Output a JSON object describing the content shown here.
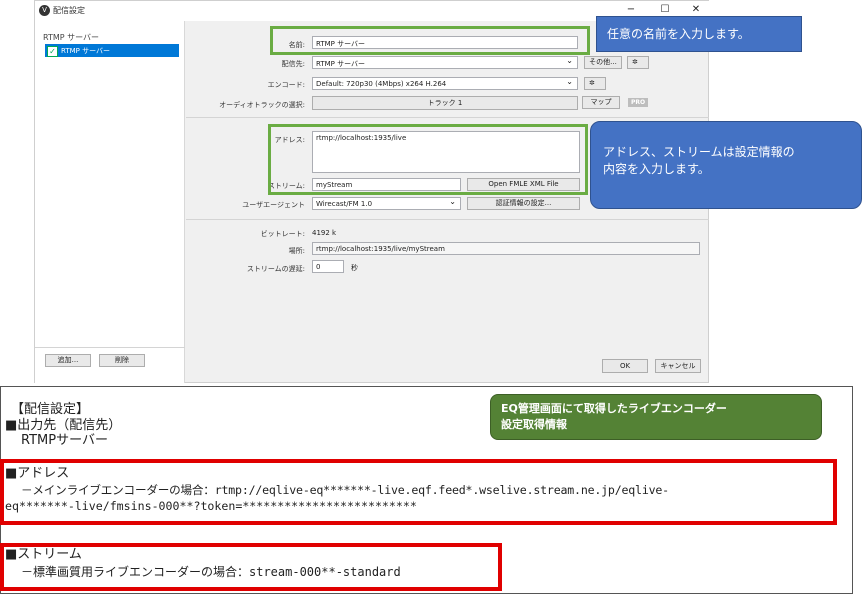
{
  "window": {
    "title": "配信設定",
    "app_icon": "V",
    "controls": [
      "−",
      "☐",
      "✕"
    ]
  },
  "sidebar": {
    "group_label": "RTMP サーバー",
    "items": [
      {
        "label": "RTMP サーバー",
        "checked": "✓"
      }
    ],
    "add_button": "追加...",
    "remove_button": "削除"
  },
  "form": {
    "name_label": "名前:",
    "name_value": "RTMP サーバー",
    "dest_label": "配信先:",
    "dest_value": "RTMP サーバー",
    "other_button": "その他...",
    "gear1": "✲",
    "encode_label": "エンコード:",
    "encode_value": "Default: 720p30 (4Mbps) x264 H.264",
    "gear2": "✲",
    "audio_label": "オーディオトラックの選択:",
    "audio_value": "トラック 1",
    "map_button": "マップ",
    "pro_badge": "PRO",
    "address_label": "アドレス:",
    "address_value": "rtmp://localhost:1935/live",
    "stream_label": "ストリーム:",
    "stream_value": "myStream",
    "fmle_button": "Open FMLE XML File",
    "useragent_label": "ユーザエージェント",
    "useragent_value": "Wirecast/FM 1.0",
    "auth_button": "認証情報の設定...",
    "bitrate_label": "ビットレート:",
    "bitrate_value": "4192 k",
    "location_label": "場所:",
    "location_value": "rtmp://localhost:1935/live/myStream",
    "delay_label": "ストリームの遅延:",
    "delay_value": "0",
    "delay_unit": "秒",
    "ok_button": "OK",
    "cancel_button": "キャンセル"
  },
  "callouts": {
    "name": "任意の名前を入力します。",
    "address_line1": "アドレス、ストリームは設定情報の",
    "address_line2": "内容を入力します。"
  },
  "doc": {
    "heading": "【配信設定】",
    "dest_title": "■出力先（配信先）",
    "dest_value": "RTMPサーバー",
    "eq_line1": "EQ管理画面にて取得したライブエンコーダー",
    "eq_line2": "設定取得情報",
    "address_title": "■アドレス",
    "address_line1": "－メインライブエンコーダーの場合：rtmp://eqlive-eq*******-live.eqf.feed*.wselive.stream.ne.jp/eqlive-",
    "address_line2": "eq*******-live/fmsins-000**?token=*************************",
    "stream_title": "■ストリーム",
    "stream_line": "－標準画質用ライブエンコーダーの場合：stream-000**-standard"
  }
}
